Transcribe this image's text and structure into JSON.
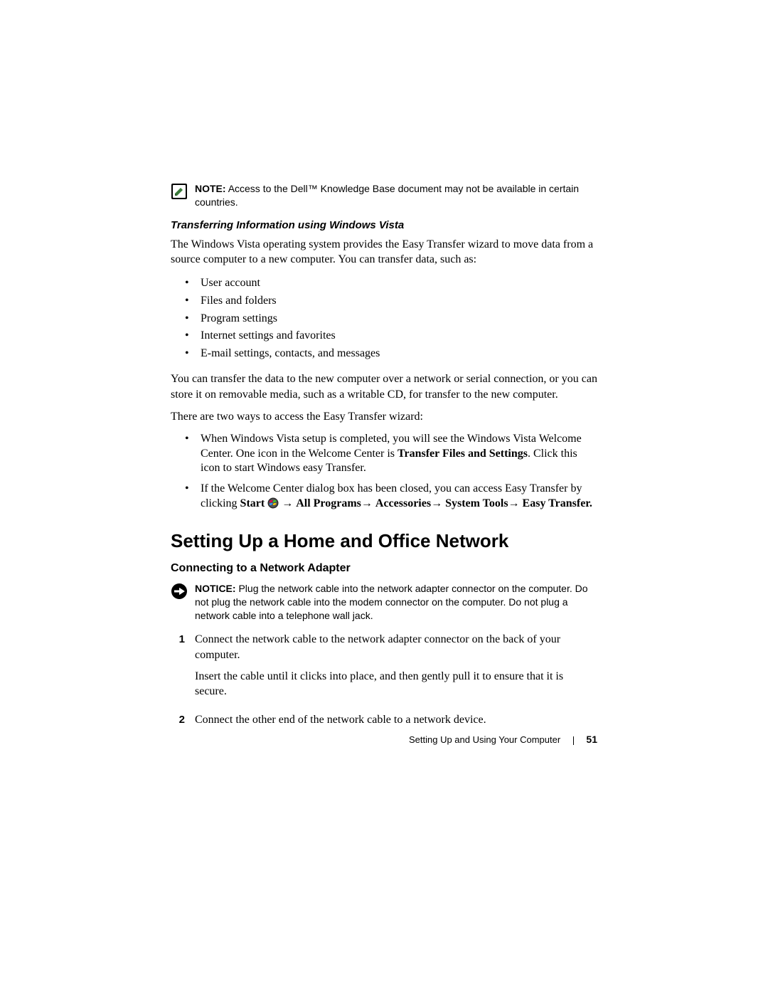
{
  "note": {
    "label": "NOTE:",
    "text": "Access to the Dell™ Knowledge Base document may not be available in certain countries."
  },
  "subsub_heading": "Transferring Information using Windows Vista",
  "intro_para": "The Windows Vista operating system provides the Easy Transfer wizard to move data from a source computer to a new computer. You can transfer data, such as:",
  "transfer_items": [
    "User account",
    "Files and folders",
    "Program settings",
    "Internet settings and favorites",
    "E-mail settings, contacts, and messages"
  ],
  "para_after_list": "You can transfer the data to the new computer over a network or serial connection, or you can store it on removable media, such as a writable CD, for transfer to the new computer.",
  "para_two_ways": "There are two ways to access the Easy Transfer wizard:",
  "ways": {
    "item1_pre": "When Windows Vista setup is completed, you will see the Windows Vista Welcome Center. One icon in the Welcome Center is ",
    "item1_bold": "Transfer Files and Settings",
    "item1_post": ". Click this icon to start Windows easy Transfer.",
    "item2_pre": "If the Welcome Center dialog box has been closed, you can access Easy Transfer by clicking ",
    "start_label": "Start",
    "all_programs": "All Programs",
    "accessories": "Accessories",
    "system_tools": "System Tools",
    "easy_transfer": "Easy Transfer."
  },
  "arrow": "→",
  "section_heading": "Setting Up a Home and Office Network",
  "subsection_heading": "Connecting to a Network Adapter",
  "notice": {
    "label": "NOTICE:",
    "text": "Plug the network cable into the network adapter connector on the computer. Do not plug the network cable into the modem connector on the computer. Do not plug a network cable into a telephone wall jack."
  },
  "steps": [
    {
      "num": "1",
      "para1": "Connect the network cable to the network adapter connector on the back of your computer.",
      "para2": "Insert the cable until it clicks into place, and then gently pull it to ensure that it is secure."
    },
    {
      "num": "2",
      "para1": "Connect the other end of the network cable to a network device."
    }
  ],
  "footer": {
    "title": "Setting Up and Using Your Computer",
    "page": "51"
  }
}
